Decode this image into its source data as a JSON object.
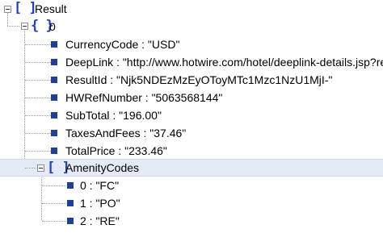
{
  "tree": {
    "root": {
      "label": "Result",
      "bracket": "[ ]"
    },
    "item0": {
      "label": "0",
      "bracket": "{ }"
    },
    "fields": [
      {
        "text": "CurrencyCode : \"USD\""
      },
      {
        "text": "DeepLink : \"http://www.hotwire.com/hotel/deeplink-details.jsp?resu"
      },
      {
        "text": "ResultId : \"Njk5NDEzMzEyOToyMTc1Mzc1NzU1MjI-\""
      },
      {
        "text": "HWRefNumber : \"5063568144\""
      },
      {
        "text": "SubTotal : \"196.00\""
      },
      {
        "text": "TaxesAndFees : \"37.46\""
      },
      {
        "text": "TotalPrice : \"233.46\""
      }
    ],
    "amenity": {
      "label": "AmenityCodes",
      "bracket": "[ ]"
    },
    "amenity_items": [
      {
        "text": "0 : \"FC\""
      },
      {
        "text": "1 : \"PO\""
      },
      {
        "text": "2 : \"RE\""
      }
    ]
  },
  "colors": {
    "bracket": "#1f3fbf",
    "bullet": "#1f3f9a",
    "selection": "#e4ebf6"
  },
  "icons": {
    "toggle": "collapse-minus-icon",
    "leaf": "leaf-square-icon"
  }
}
